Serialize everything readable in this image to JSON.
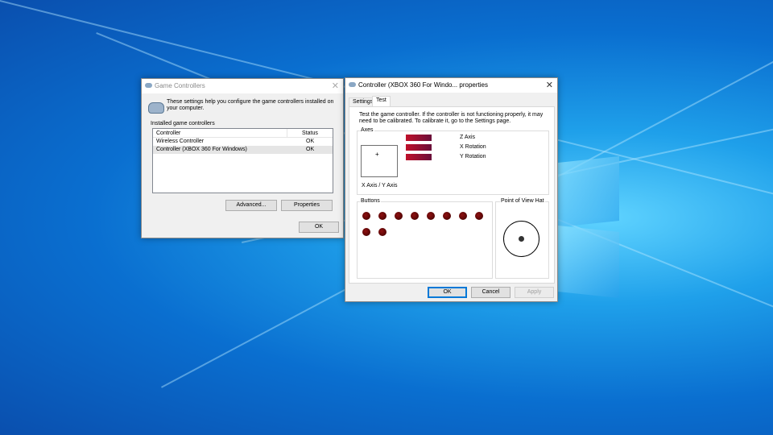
{
  "game_controllers": {
    "title": "Game Controllers",
    "description": "These settings help you configure the game controllers installed on your computer.",
    "group_label": "Installed game controllers",
    "columns": [
      "Controller",
      "Status"
    ],
    "rows": [
      {
        "name": "Wireless Controller",
        "status": "OK"
      },
      {
        "name": "Controller (XBOX 360 For Windows)",
        "status": "OK"
      }
    ],
    "advanced_label": "Advanced...",
    "properties_label": "Properties",
    "ok_label": "OK"
  },
  "properties": {
    "title": "Controller (XBOX 360 For Windo... properties",
    "tabs": [
      "Settings",
      "Test"
    ],
    "active_tab": "Test",
    "instructions": "Test the game controller.  If the controller is not functioning properly, it may need to be calibrated.  To calibrate it, go to the Settings page.",
    "axes": {
      "label": "Axes",
      "xy_label": "X Axis / Y Axis",
      "crosshair": "+",
      "z_axis": "Z Axis",
      "x_rotation": "X Rotation",
      "y_rotation": "Y Rotation"
    },
    "buttons": {
      "label": "Buttons",
      "count": 10
    },
    "pov": {
      "label": "Point of View Hat"
    },
    "ok_label": "OK",
    "cancel_label": "Cancel",
    "apply_label": "Apply"
  },
  "icons": {
    "close": "✕"
  },
  "colors": {
    "axis_bar": "#c0102a",
    "button_dot": "#6a0000",
    "accent": "#0078d7"
  }
}
